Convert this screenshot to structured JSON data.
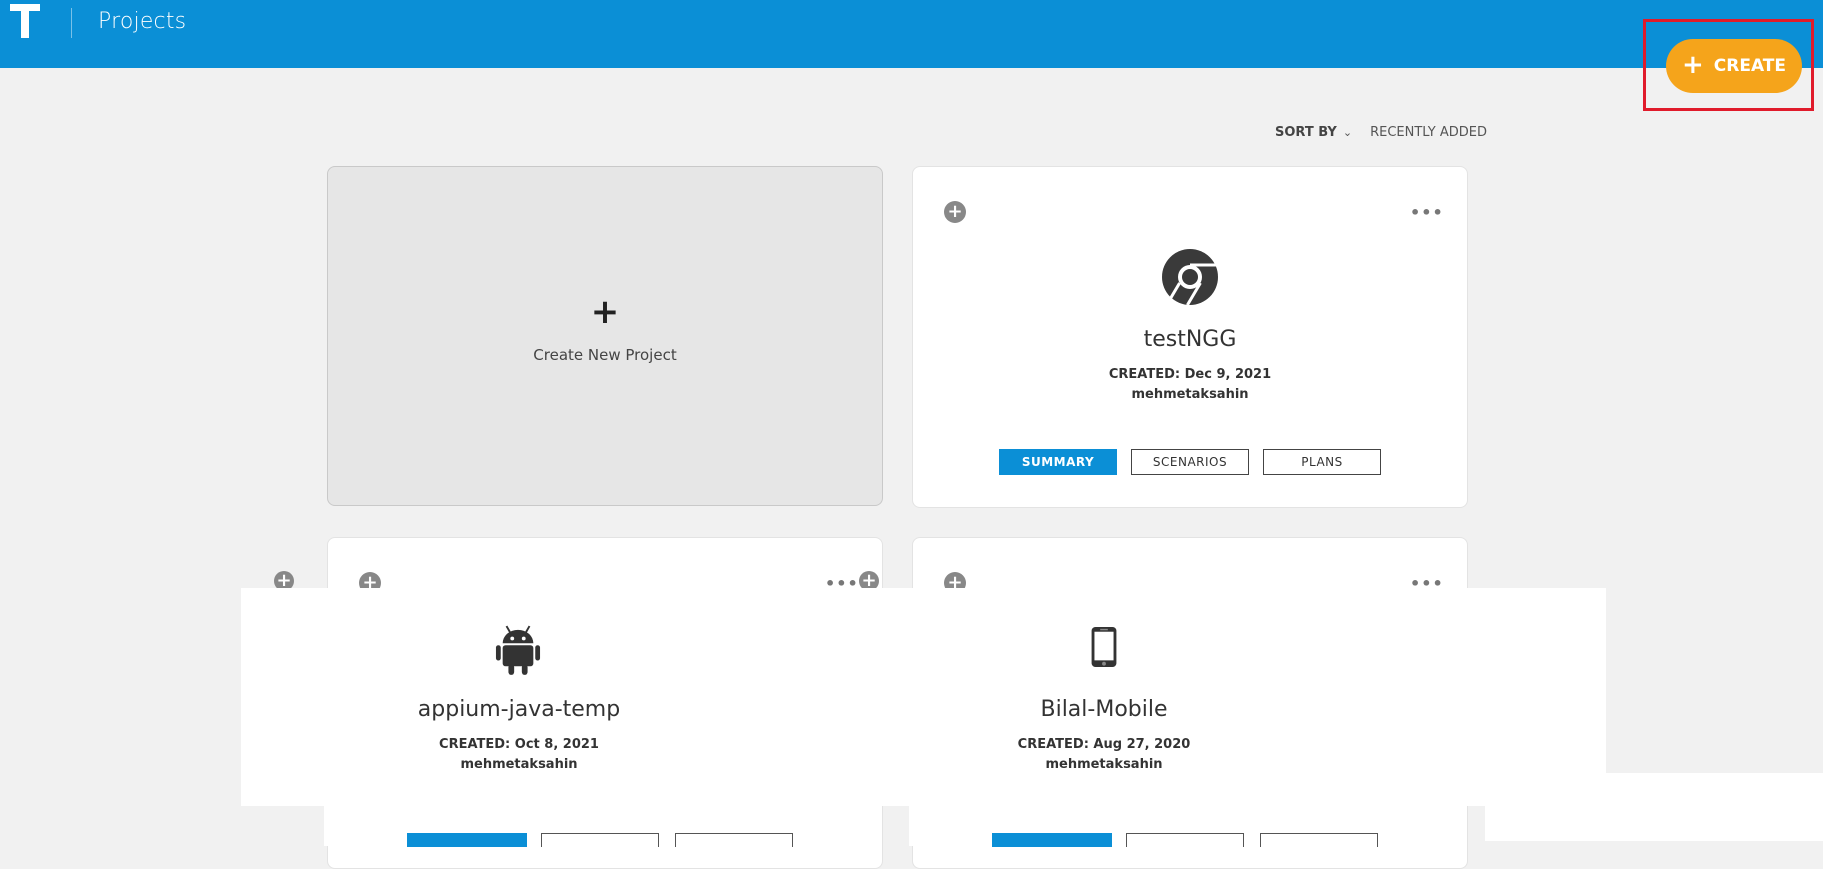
{
  "header": {
    "title": "Projects",
    "create_label": "CREATE",
    "create_plus": "+"
  },
  "sort": {
    "label": "SORT BY",
    "value": "RECENTLY ADDED"
  },
  "new_project": {
    "plus": "+",
    "label": "Create New Project"
  },
  "cards": [
    {
      "name": "testNGG",
      "icon": "chrome-icon",
      "created": "CREATED: Dec 9, 2021",
      "owner": "mehmetaksahin",
      "buttons": [
        "SUMMARY",
        "SCENARIOS",
        "PLANS"
      ]
    },
    {
      "name": "appium-java-temp",
      "icon": "android-icon",
      "created": "CREATED: Oct 8, 2021",
      "owner": "mehmetaksahin",
      "buttons": [
        "",
        "",
        ""
      ]
    },
    {
      "name": "Bilal-Mobile",
      "icon": "mobile-phone-icon",
      "created": "CREATED: Aug 27, 2020",
      "owner": "mehmetaksahin",
      "buttons": [
        "",
        "",
        ""
      ]
    }
  ],
  "colors": {
    "header": "#0b8fd6",
    "create_button": "#f5a41b",
    "highlight": "#e01b2b",
    "primary_button": "#0b8fd6"
  }
}
